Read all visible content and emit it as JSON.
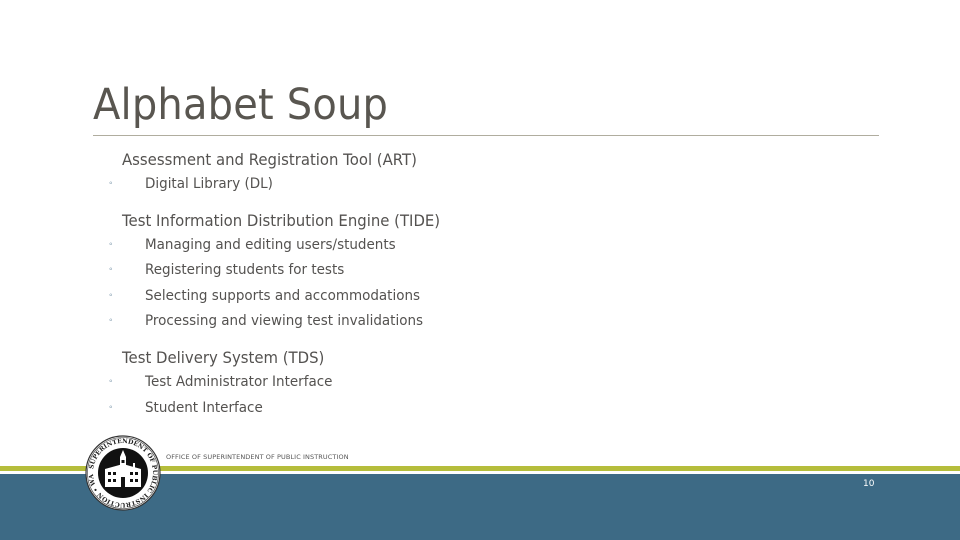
{
  "slide": {
    "title": "Alphabet Soup",
    "sections": [
      {
        "heading": "Assessment and Registration Tool (ART)",
        "items": [
          "Digital Library (DL)"
        ]
      },
      {
        "heading": "Test Information Distribution Engine (TIDE)",
        "items": [
          "Managing and editing users/students",
          "Registering students for tests",
          "Selecting supports and accommodations",
          "Processing and viewing test invalidations"
        ]
      },
      {
        "heading": "Test Delivery System (TDS)",
        "items": [
          "Test Administrator Interface",
          "Student Interface"
        ]
      }
    ],
    "bullet_glyph": "◦"
  },
  "footer": {
    "organization": "OFFICE OF SUPERINTENDENT OF PUBLIC INSTRUCTION",
    "page_number": "10",
    "seal_icon": "ospi-seal-icon",
    "colors": {
      "accent_green": "#b5bd3b",
      "band_blue": "#3d6a85",
      "text_gray": "#545250"
    }
  }
}
